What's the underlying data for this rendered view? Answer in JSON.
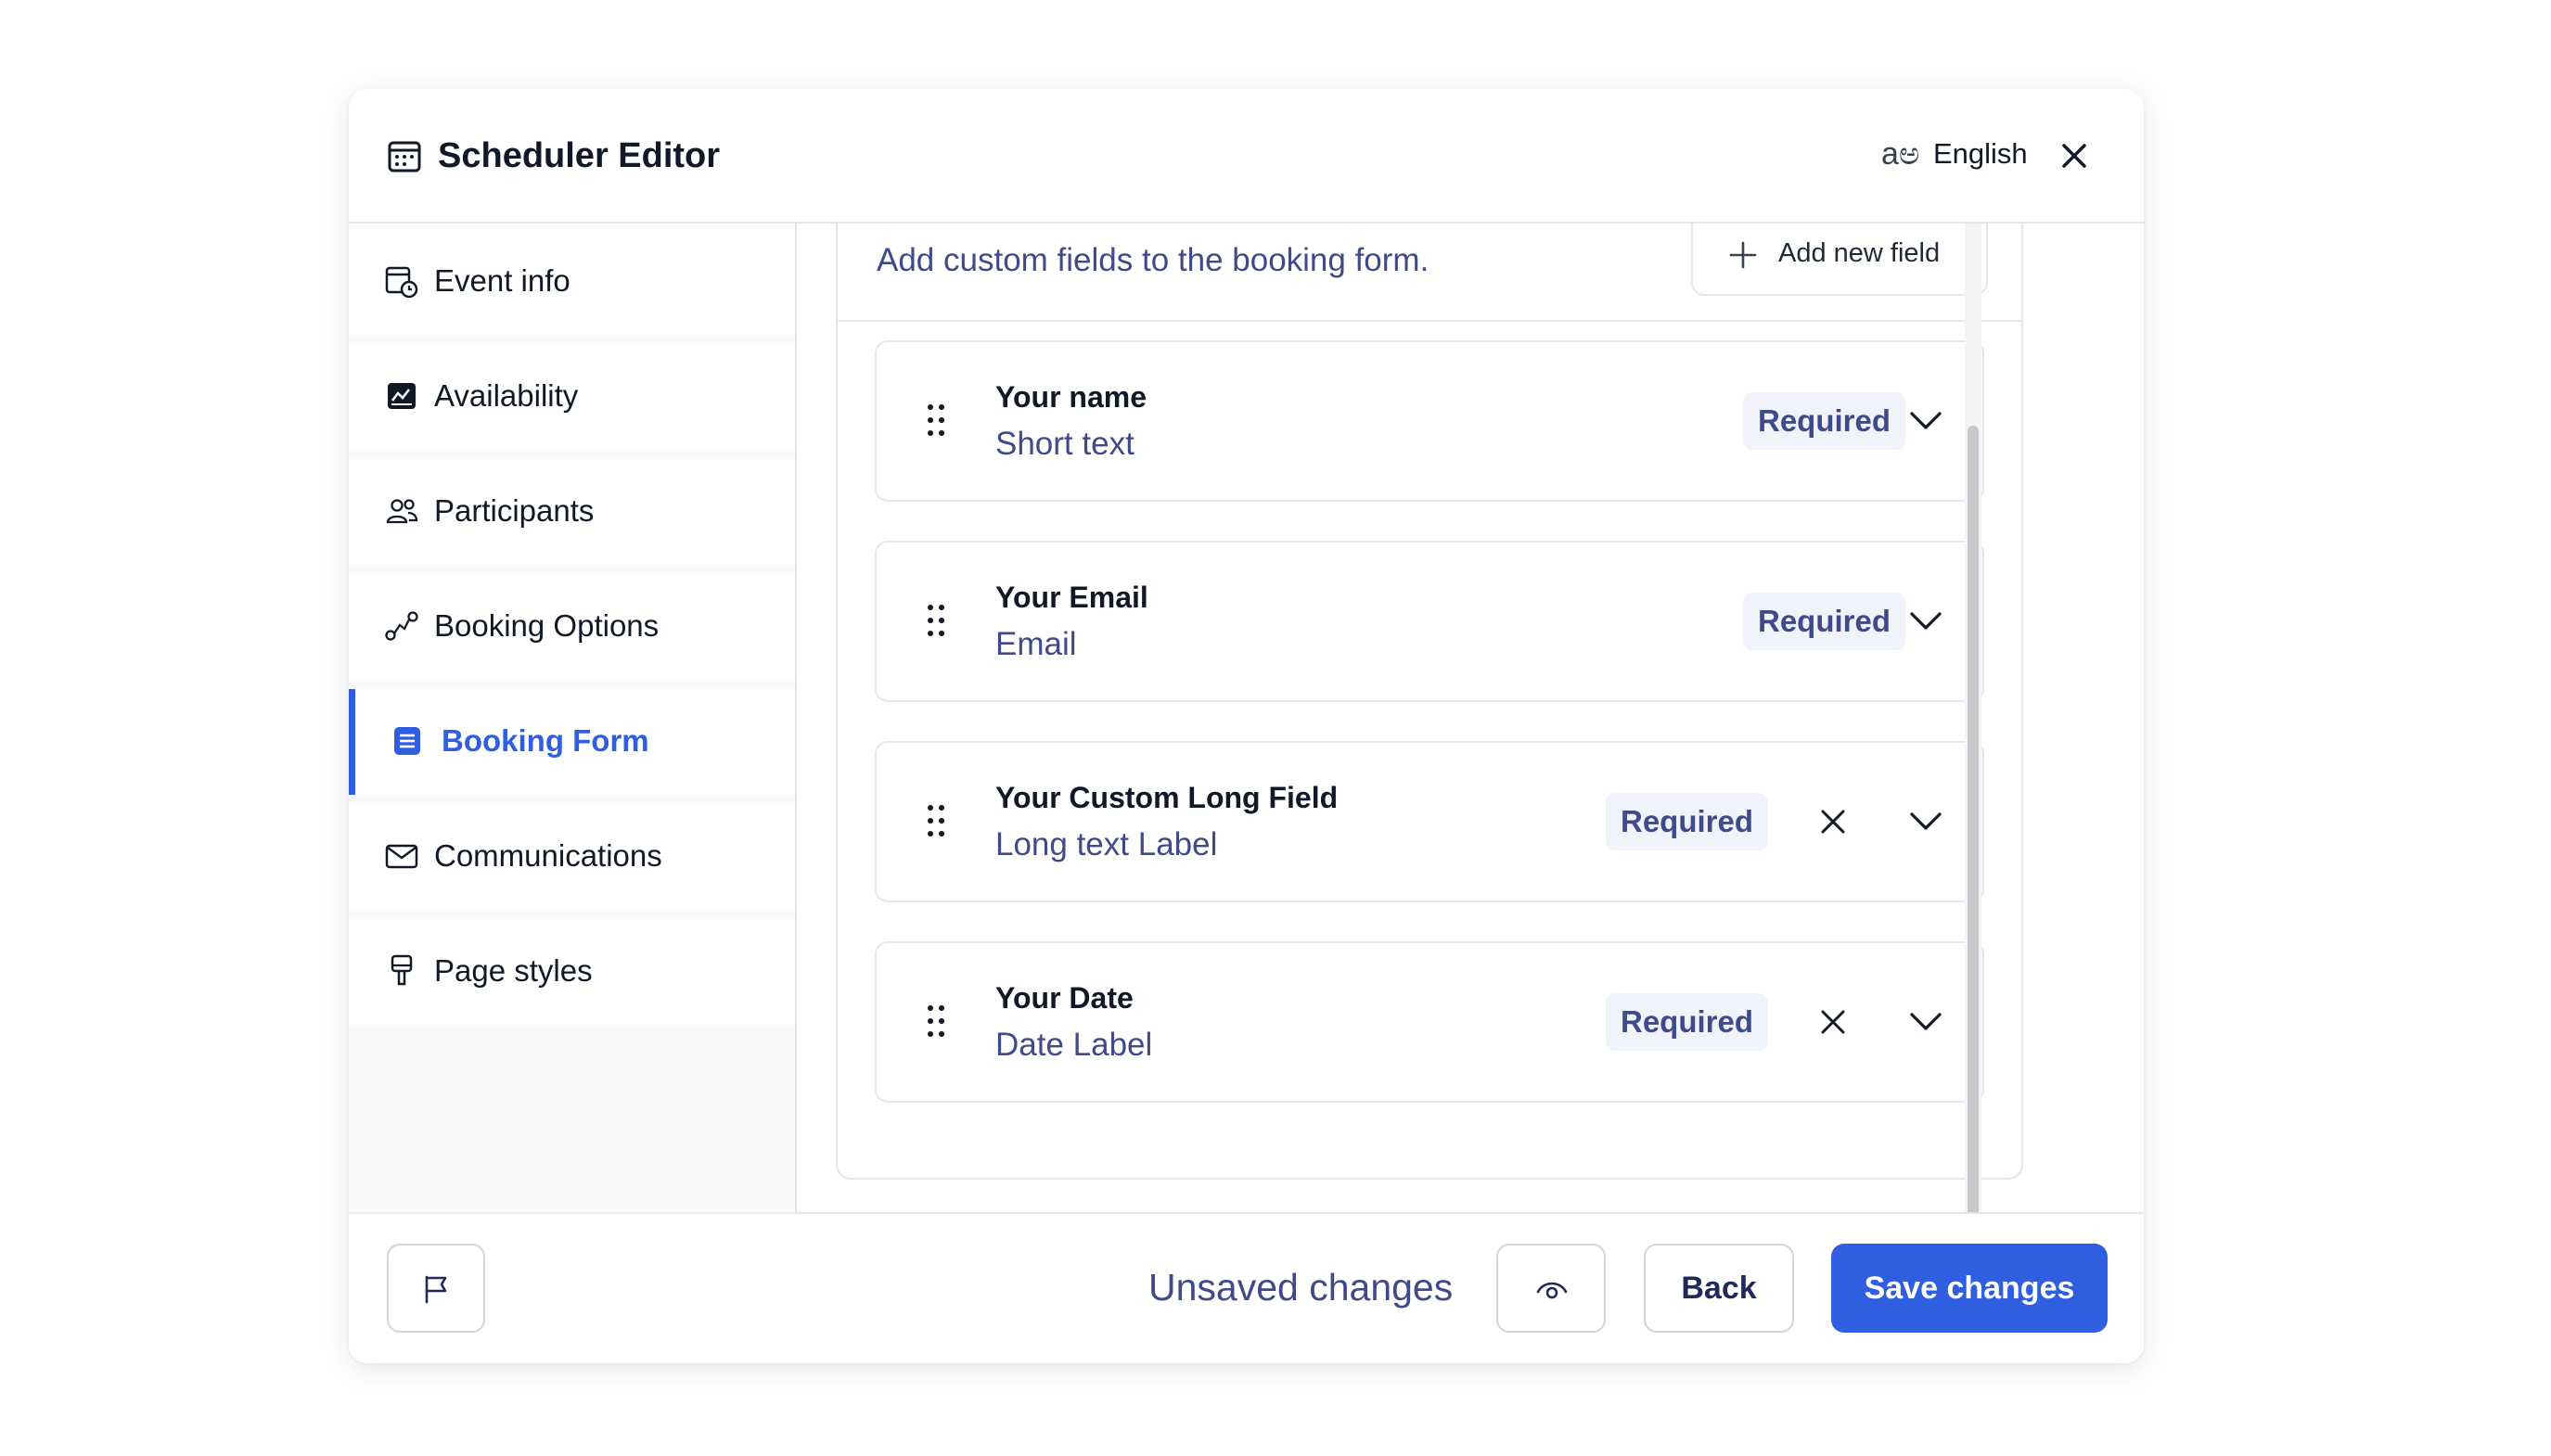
{
  "header": {
    "title": "Scheduler Editor",
    "title_icon": "calendar-icon",
    "language_icon": "translate-icon",
    "language": "English",
    "close_icon": "close-icon"
  },
  "sidebar": {
    "items": [
      {
        "label": "Event info",
        "icon": "calendar-clock-icon",
        "active": false
      },
      {
        "label": "Availability",
        "icon": "availability-icon",
        "active": false
      },
      {
        "label": "Participants",
        "icon": "users-icon",
        "active": false
      },
      {
        "label": "Booking Options",
        "icon": "route-icon",
        "active": false
      },
      {
        "label": "Booking Form",
        "icon": "document-icon",
        "active": true
      },
      {
        "label": "Communications",
        "icon": "mail-icon",
        "active": false
      },
      {
        "label": "Page styles",
        "icon": "paintbrush-icon",
        "active": false
      }
    ]
  },
  "main": {
    "description": "Add custom fields to the booking form.",
    "add_field_label": "Add new field",
    "fields": [
      {
        "name": "Your name",
        "type": "Short text",
        "badge": "Required",
        "removable": false
      },
      {
        "name": "Your Email",
        "type": "Email",
        "badge": "Required",
        "removable": false
      },
      {
        "name": "Your Custom Long Field",
        "type": "Long text Label",
        "badge": "Required",
        "removable": true
      },
      {
        "name": "Your Date",
        "type": "Date Label",
        "badge": "Required",
        "removable": true
      }
    ]
  },
  "footer": {
    "flag_icon": "flag-icon",
    "status": "Unsaved changes",
    "preview_icon": "eye-icon",
    "back_label": "Back",
    "save_label": "Save changes"
  },
  "colors": {
    "accent": "#2f5fe0",
    "muted_text": "#3e4a8a",
    "badge_bg": "#f1f3fb",
    "border": "#e5e7eb"
  }
}
